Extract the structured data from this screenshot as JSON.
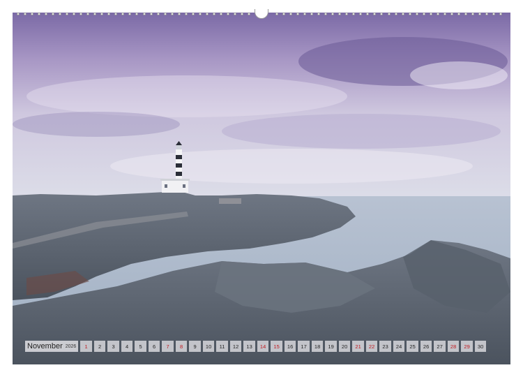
{
  "calendar": {
    "month": "November",
    "year": "2026",
    "days": [
      {
        "n": "1",
        "red": true
      },
      {
        "n": "2",
        "red": false
      },
      {
        "n": "3",
        "red": false
      },
      {
        "n": "4",
        "red": false
      },
      {
        "n": "5",
        "red": false
      },
      {
        "n": "6",
        "red": false
      },
      {
        "n": "7",
        "red": true
      },
      {
        "n": "8",
        "red": true
      },
      {
        "n": "9",
        "red": false
      },
      {
        "n": "10",
        "red": false
      },
      {
        "n": "11",
        "red": false
      },
      {
        "n": "12",
        "red": false
      },
      {
        "n": "13",
        "red": false
      },
      {
        "n": "14",
        "red": true
      },
      {
        "n": "15",
        "red": true
      },
      {
        "n": "16",
        "red": false
      },
      {
        "n": "17",
        "red": false
      },
      {
        "n": "18",
        "red": false
      },
      {
        "n": "19",
        "red": false
      },
      {
        "n": "20",
        "red": false
      },
      {
        "n": "21",
        "red": true
      },
      {
        "n": "22",
        "red": true
      },
      {
        "n": "23",
        "red": false
      },
      {
        "n": "24",
        "red": false
      },
      {
        "n": "25",
        "red": false
      },
      {
        "n": "26",
        "red": false
      },
      {
        "n": "27",
        "red": false
      },
      {
        "n": "28",
        "red": true
      },
      {
        "n": "29",
        "red": true
      },
      {
        "n": "30",
        "red": false
      }
    ]
  },
  "colors": {
    "holiday": "#c0191f",
    "sky_top": "#7e6fa8",
    "sea": "#a9b7c9",
    "rock": "#5f6a76"
  }
}
